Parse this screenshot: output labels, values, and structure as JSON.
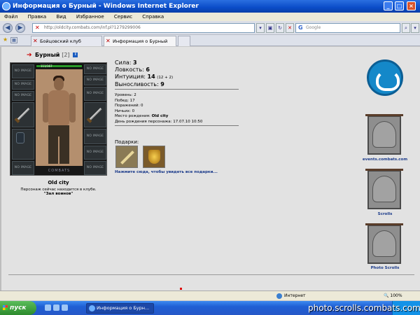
{
  "window": {
    "title": "Информация о Бурный - Windows Internet Explorer"
  },
  "menu": [
    "Файл",
    "Правка",
    "Вид",
    "Избранное",
    "Сервис",
    "Справка"
  ],
  "address": {
    "url": "http://oldcity.combats.com/inf.pl?1279299006",
    "search_placeholder": "Google"
  },
  "tabs": [
    {
      "label": "Бойцовский клуб"
    },
    {
      "label": "Информация о Бурный"
    }
  ],
  "character": {
    "name": "Бурный",
    "level": "[2]",
    "hp": "111/167",
    "no_image": "NO IMAGE",
    "doll_logo": "COMBATS",
    "city": "Old city",
    "status": "Персонаж сейчас находится в клубе.",
    "room": "\"Зал воинов\""
  },
  "stats": {
    "strength_label": "Сила:",
    "strength": "3",
    "agility_label": "Ловкость:",
    "agility": "6",
    "intuition_label": "Интуиция:",
    "intuition": "14",
    "intuition_bonus": "(12 + 2)",
    "endurance_label": "Выносливость:",
    "endurance": "9"
  },
  "info": {
    "level": "Уровень: 2",
    "wins": "Побед: 17",
    "losses": "Поражений: 0",
    "draws": "Ничьих: 0",
    "birthplace_label": "Место рождения:",
    "birthplace": "Old city",
    "birthday": "День рождения персонажа: 17.07.10 10:50"
  },
  "gifts": {
    "label": "Подарки:",
    "link": "Нажмите сюда, чтобы увидеть все подарки..."
  },
  "sidebar": {
    "banner1_label": "events.combats.com",
    "banner2_label": "Scrolls",
    "banner3_label": "Photo Scrolls"
  },
  "statusbar": {
    "zone": "Интернет",
    "zoom": "100%"
  },
  "taskbar": {
    "start": "пуск",
    "task": "Информация о Бурн...",
    "clock": ""
  },
  "watermark": "photo.scrolls.combats.com"
}
